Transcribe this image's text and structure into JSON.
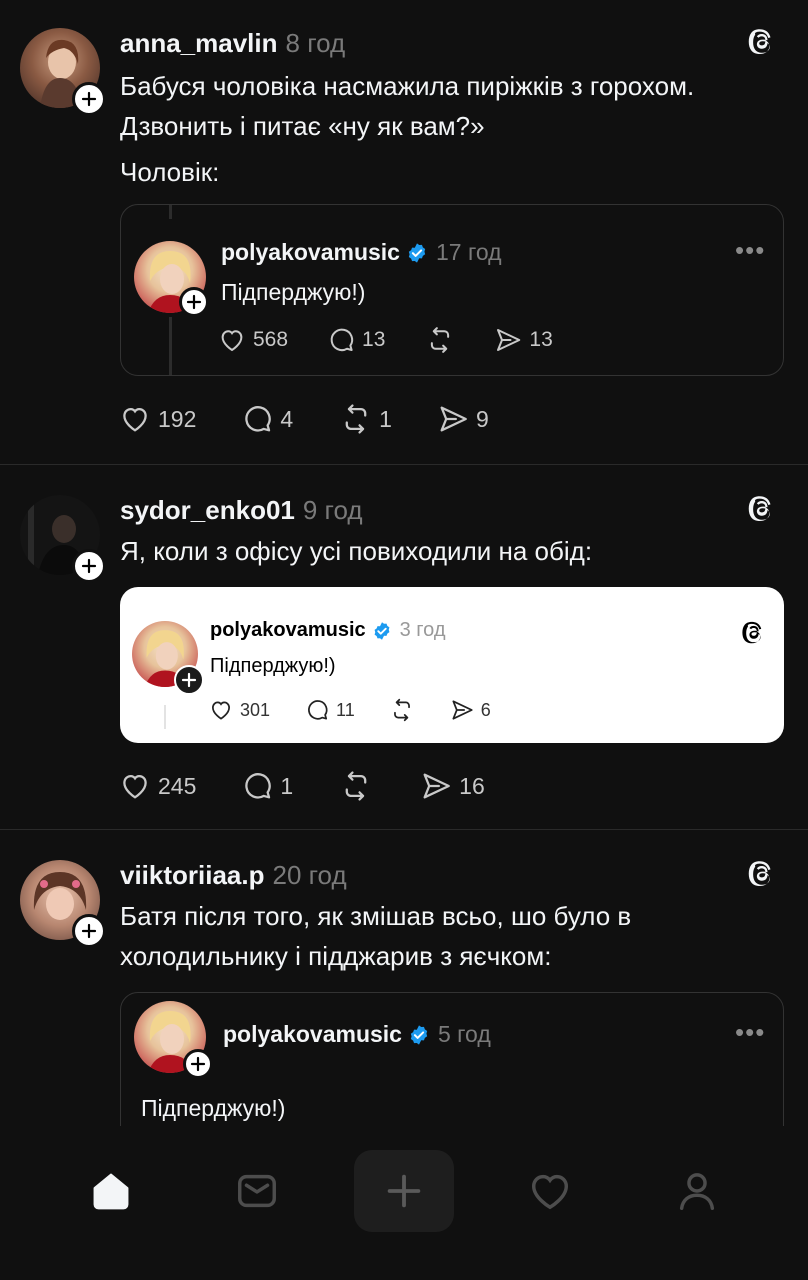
{
  "posts": [
    {
      "username": "anna_mavlin",
      "time": "8 год",
      "lines": [
        "Бабуся чоловіка насмажила пиріжків з горохом.",
        "Дзвонить і питає «ну як вам?»",
        "Чоловік:"
      ],
      "quote": {
        "username": "polyakovamusic",
        "time": "17 год",
        "text": "Підперджую!)",
        "likes": "568",
        "replies": "13",
        "shares": "13"
      },
      "likes": "192",
      "replies": "4",
      "reposts": "1",
      "shares": "9"
    },
    {
      "username": "sydor_enko01",
      "time": "9 год",
      "lines": [
        "Я, коли з офісу усі повиходили на обід:"
      ],
      "quote": {
        "username": "polyakovamusic",
        "time": "3 год",
        "text": "Підперджую!)",
        "likes": "301",
        "replies": "11",
        "shares": "6"
      },
      "likes": "245",
      "replies": "1",
      "shares": "16"
    },
    {
      "username": "viiktoriiaa.p",
      "time": "20 год",
      "lines": [
        "Батя після того, як змішав всьо, шо було в",
        "холодильнику і підджарив з яєчком:"
      ],
      "quote": {
        "username": "polyakovamusic",
        "time": "5 год",
        "text": "Підперджую!)"
      }
    }
  ],
  "icons": {
    "more": "•••",
    "tabs": [
      "home-icon",
      "inbox-icon",
      "create-icon",
      "activity-heart-icon",
      "profile-icon"
    ]
  },
  "colors": {
    "background": "#101010",
    "verified": "#1d9bf0"
  }
}
